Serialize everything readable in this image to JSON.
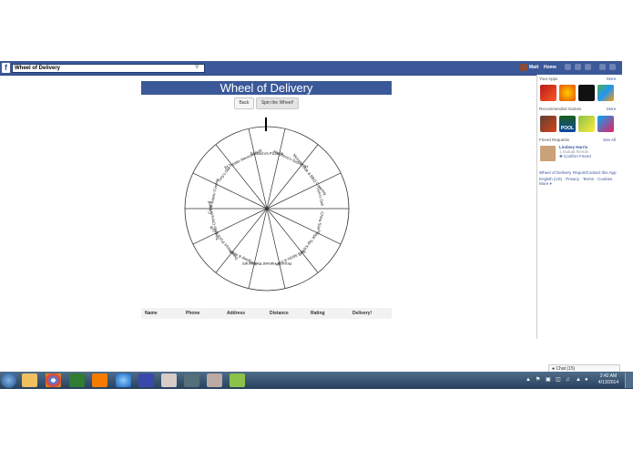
{
  "browser": {
    "search_value": "Wheel of Delivery",
    "user_name": "Matt",
    "home_label": "Home"
  },
  "main": {
    "title": "Wheel of Delivery",
    "back_label": "Back",
    "spin_label": "Spin the Wheel!",
    "wheel_segments": [
      "Harpoons's Sea Food",
      "Monster Sub & BBQ Catering",
      "Gyro's Deli",
      "China Star",
      "Village Tap Kitchen",
      "Sly's Sticks & Cafe",
      "Rocco's Harvest Restaurant",
      "Wingstop & More",
      "Doughboys Pizza & Grill",
      "Tsingtao Chinese Food",
      "Carib-Bayou Cuisine",
      "Tony's Deli",
      "El Tapatio Mexican Grill",
      "Santorini's Pizzeria"
    ],
    "table_headers": [
      "Name",
      "Phone",
      "Address",
      "Distance",
      "Rating",
      "Delivery!"
    ]
  },
  "sidebar": {
    "your_apps_label": "Your Apps",
    "your_apps_more": "More",
    "recommended_label": "Recommended Games",
    "recommended_more": "More",
    "pool_label": "POOL",
    "friend_requests_label": "Friend Requests",
    "friend_requests_seeall": "See All",
    "friend_name": "Lindsey Harris",
    "friend_mutual": "1 mutual friends",
    "confirm_label": "Confirm Friend",
    "footer_line1_a": "Wheel of Delivery",
    "footer_line1_b": "Report/Contact this App",
    "footer_line2": "English (US) · Privacy · Terms · Cookies",
    "footer_line3": "More ▾"
  },
  "chat": {
    "label": "Chat (15)"
  },
  "taskbar": {
    "time": "2:42 AM",
    "date": "4/13/2014"
  },
  "colors": {
    "facebook_blue": "#3b5998",
    "taskbar": "#27405c"
  },
  "icons": {
    "search": "search-icon",
    "start": "windows-start-icon"
  }
}
